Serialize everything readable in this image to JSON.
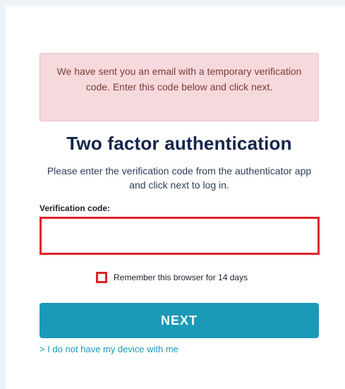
{
  "alert": {
    "message": "We have sent you an email with a temporary verification code. Enter this code below and click next."
  },
  "title": "Two factor authentication",
  "subtitle": "Please enter the verification code from the authenticator app and click next to log in.",
  "form": {
    "code_label": "Verification code:",
    "code_value": "",
    "remember_label": "Remember this browser for 14 days",
    "remember_checked": false,
    "next_label": "NEXT",
    "no_device_link": "> I do not have my device with me"
  },
  "colors": {
    "alert_bg": "#f6d9dc",
    "title": "#13244a",
    "error_border": "#e0232a",
    "button_bg": "#1b9ab8",
    "link": "#1b9ab8"
  }
}
